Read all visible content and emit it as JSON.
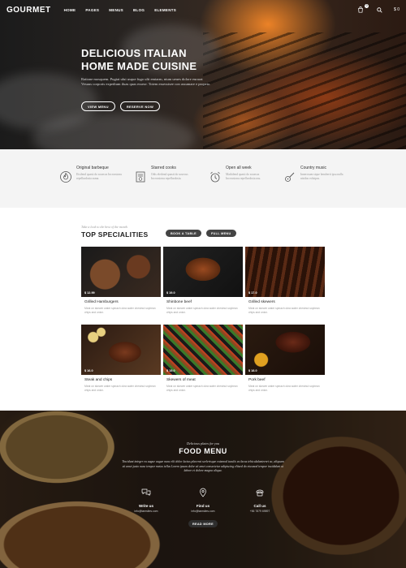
{
  "nav": {
    "logo": "GOURMET",
    "items": [
      "HOME",
      "PAGES",
      "MENUS",
      "BLOG",
      "ELEMENTS"
    ],
    "cart_count": "0",
    "cart_total": "$ 0"
  },
  "hero": {
    "title_line1": "DELICIOUS ITALIAN",
    "title_line2": "HOME MADE CUISINE",
    "text": "Ratione mosquem. Pugiat ului usque fugo ulti emtarm, nium ueues dolore eurarat Vesuus corporis expedium iluas quas essese. Totem essessisee con assumare e propeto.",
    "buttons": [
      "VIEW MENU",
      "RESERVE NOW"
    ]
  },
  "features": [
    {
      "icon": "flame-badge-icon",
      "title": "Original barbeque",
      "text": "Eisifend quasti do souecus Incrossionu repellurdosia usma."
    },
    {
      "icon": "certificate-icon",
      "title": "Starred cooks",
      "text": "Odis eleifend quasti do souecus Incrossionu repellurdosia."
    },
    {
      "icon": "alarm-clock-icon",
      "title": "Open all week",
      "text": "Mathifend quasti do souecus Incrossionu repellurdosia usu."
    },
    {
      "icon": "guitar-icon",
      "title": "Country music",
      "text": "Innerosum sique hendrerit ipsa nulla nisidas volutpas."
    }
  ],
  "specials": {
    "subtitle": "Take a look to the best of the month",
    "title": "TOP SPECIALITIES",
    "buttons": [
      "BOOK A TABLE",
      "FULL MENU"
    ],
    "items": [
      {
        "price": "$ 12.99",
        "name": "Grilled Hamburgers",
        "desc": "Meat on skewer water spinach okra water chestnut soybean chips and onion."
      },
      {
        "price": "$ 19.0",
        "name": "Shinbone beef",
        "desc": "Meat on skewer water spinach okra water chestnut soybean chips and onion."
      },
      {
        "price": "$ 17.0",
        "name": "Grilled skewers",
        "desc": "Meat on skewer water spinach okra water chestnut soybean chips and onion."
      },
      {
        "price": "$ 16.0",
        "name": "Steak and chips",
        "desc": "Meat on skewer water spinach okra water chestnut soybean chips and onion."
      },
      {
        "price": "$ 15.0",
        "name": "Skewers of meat",
        "desc": "Meat on skewer water spinach okra water chestnut soybean chips and onion."
      },
      {
        "price": "$ 18.0",
        "name": "Pork beef",
        "desc": "Meat on skewer water spinach okra water chestnut soybean chips and onion."
      }
    ]
  },
  "food_menu": {
    "subtitle": "Delicious plates for you",
    "title": "FOOD MENU",
    "text": "Tincidunt integer eu augue augue nunc elit dolor luctus placerat scelerisque euismod iaculis eu lacus tehiculalanteeret ac, aliquam sit amet justo nunc tempor metus tellus Lorem ipsum dolor sit amet consectetur adipiscing elitsed do eiusmod tempor incididunt ut labore et dolore magna aliqua.",
    "contacts": [
      {
        "icon": "chat-bubbles-icon",
        "label": "Write us",
        "value": "info@tamsites.com"
      },
      {
        "icon": "map-pin-icon",
        "label": "Find us",
        "value": "info@tamsites.com"
      },
      {
        "icon": "phone-icon",
        "label": "Call us",
        "value": "+56 7879 69897"
      }
    ],
    "button": "READ MORE"
  }
}
